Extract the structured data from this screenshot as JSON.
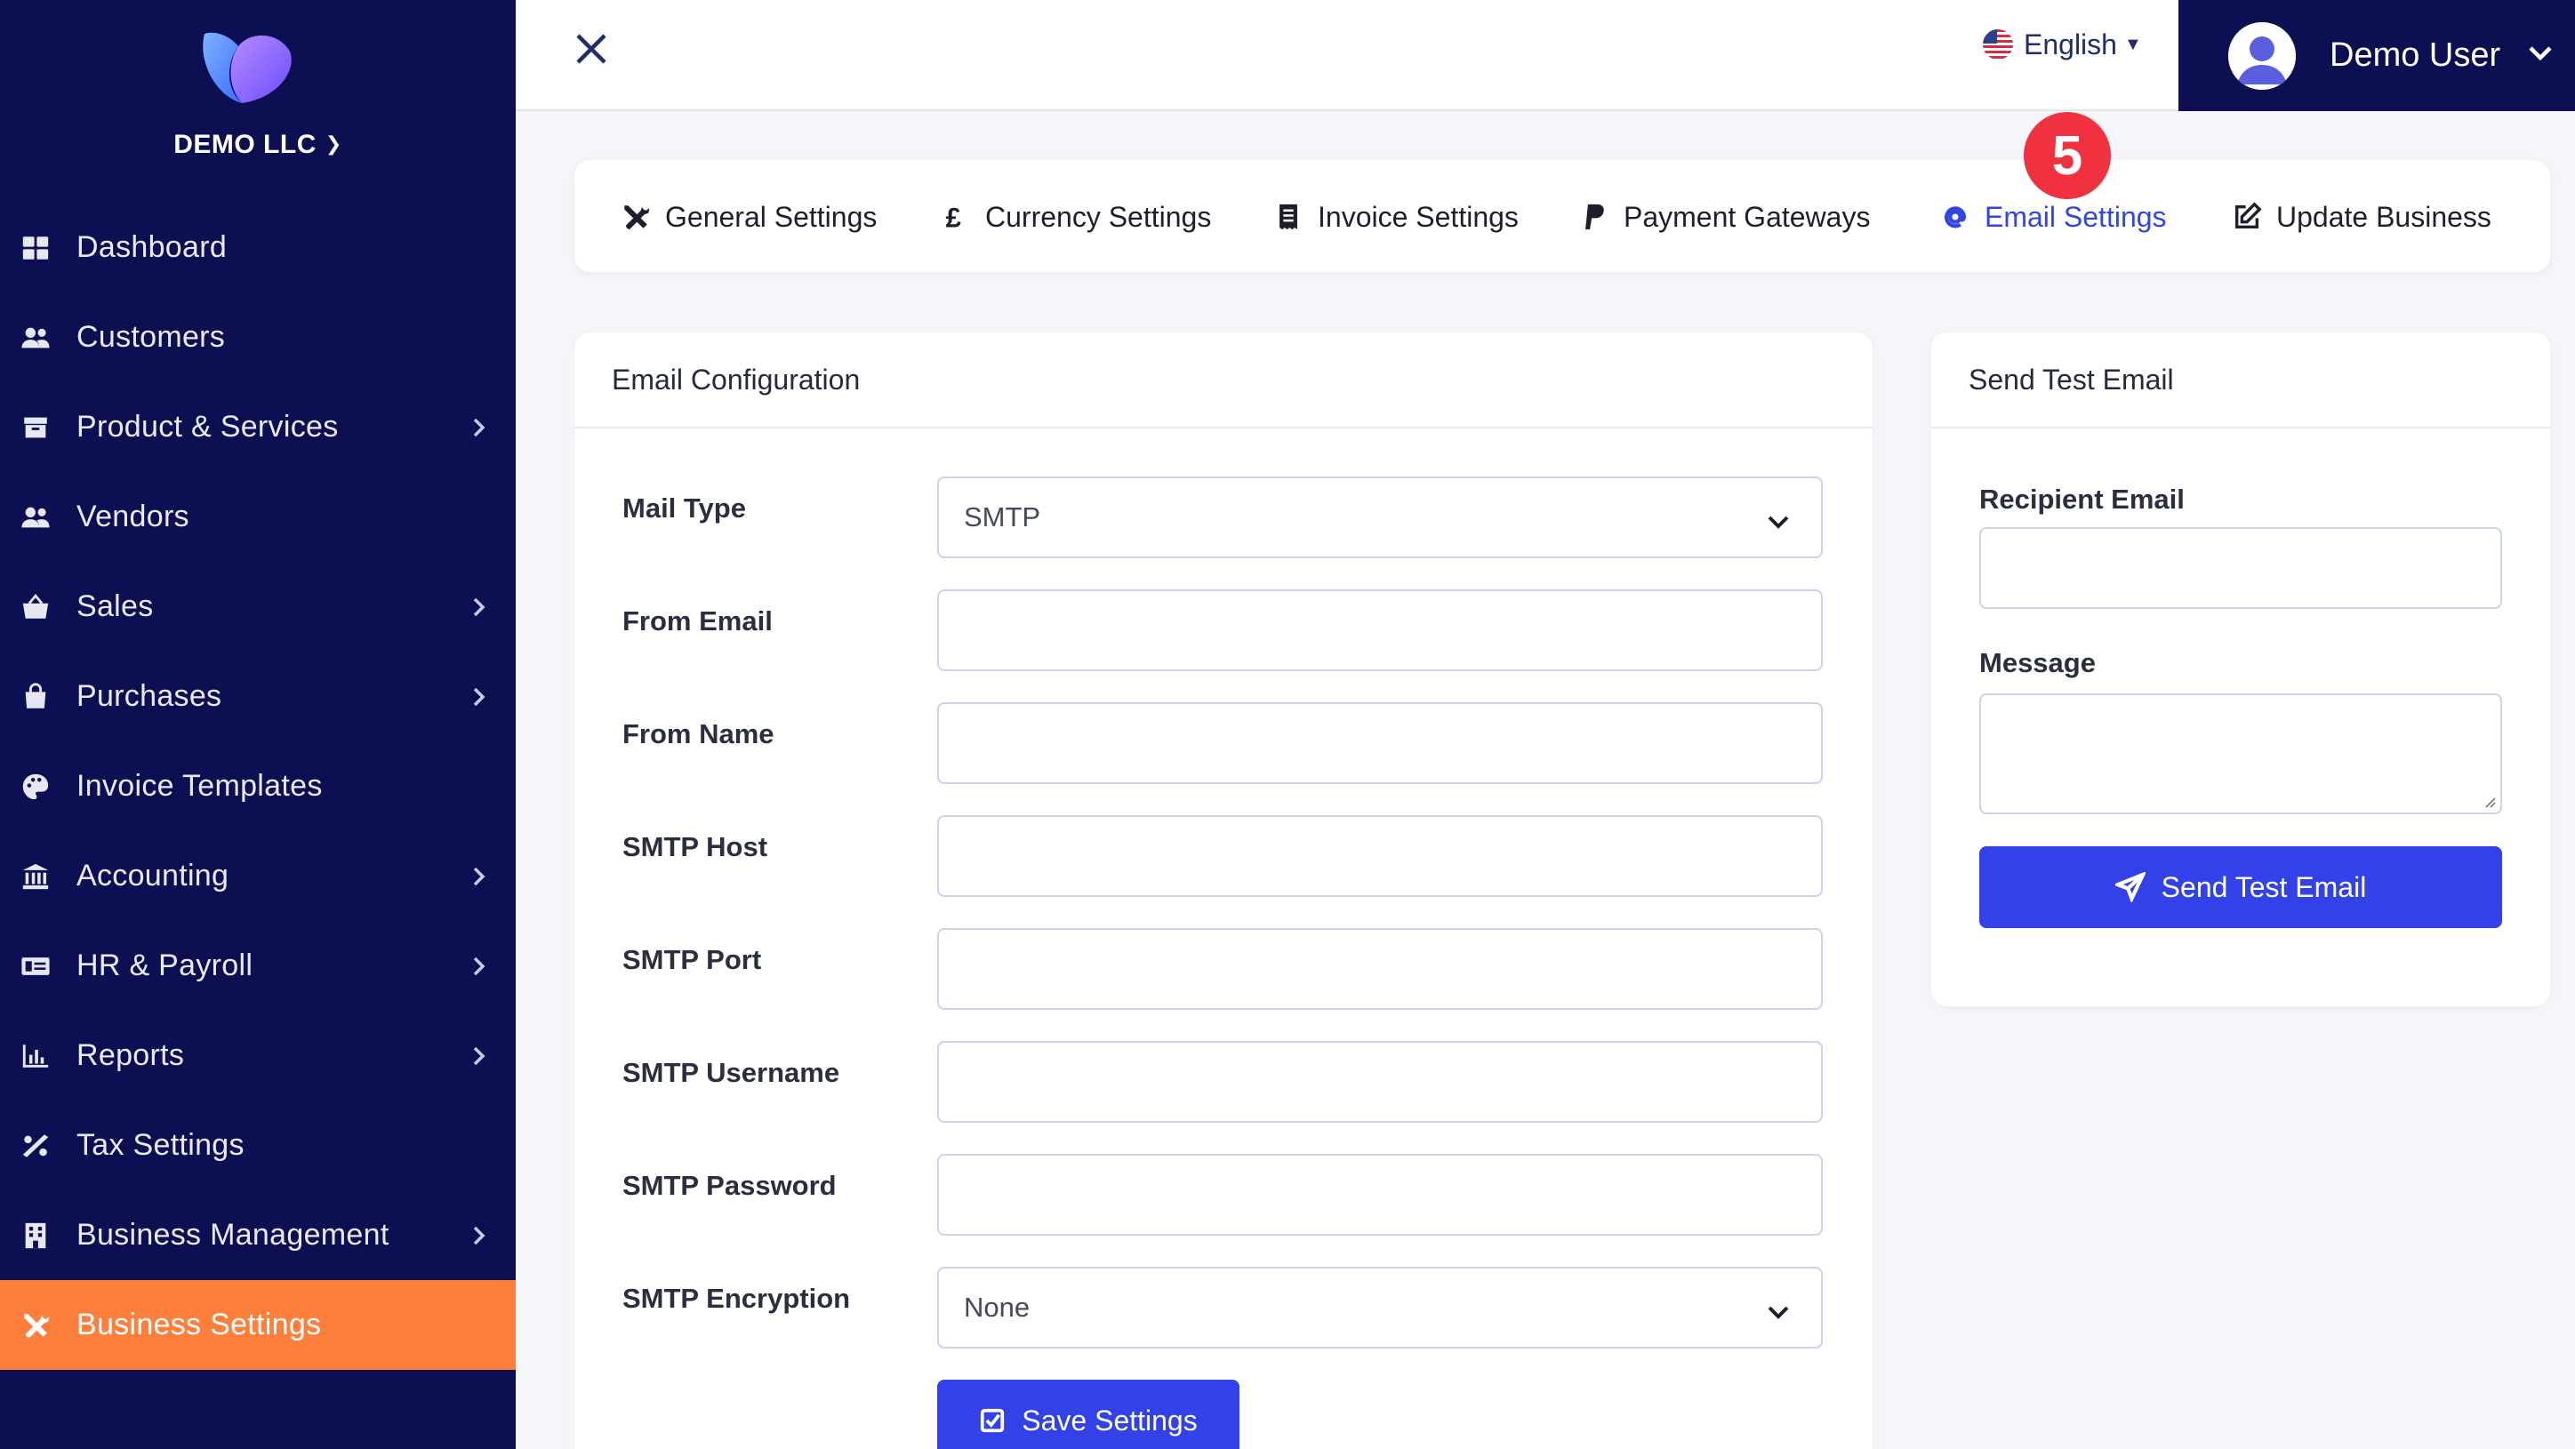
{
  "sidebar": {
    "company": "DEMO LLC",
    "items": [
      {
        "label": "Dashboard",
        "icon": "grid-icon",
        "has_submenu": false
      },
      {
        "label": "Customers",
        "icon": "users-icon",
        "has_submenu": false
      },
      {
        "label": "Product & Services",
        "icon": "box-icon",
        "has_submenu": true
      },
      {
        "label": "Vendors",
        "icon": "users-icon",
        "has_submenu": false
      },
      {
        "label": "Sales",
        "icon": "basket-icon",
        "has_submenu": true
      },
      {
        "label": "Purchases",
        "icon": "bag-icon",
        "has_submenu": true
      },
      {
        "label": "Invoice Templates",
        "icon": "palette-icon",
        "has_submenu": false
      },
      {
        "label": "Accounting",
        "icon": "bank-icon",
        "has_submenu": true
      },
      {
        "label": "HR & Payroll",
        "icon": "money-card-icon",
        "has_submenu": true
      },
      {
        "label": "Reports",
        "icon": "bar-chart-icon",
        "has_submenu": true
      },
      {
        "label": "Tax Settings",
        "icon": "percent-icon",
        "has_submenu": false
      },
      {
        "label": "Business Management",
        "icon": "building-icon",
        "has_submenu": true
      },
      {
        "label": "Business Settings",
        "icon": "tools-icon",
        "has_submenu": false,
        "active": true
      }
    ]
  },
  "topbar": {
    "language": "English",
    "user_name": "Demo User"
  },
  "tabs": [
    {
      "label": "General Settings",
      "icon": "tools-icon"
    },
    {
      "label": "Currency Settings",
      "icon": "pound-icon"
    },
    {
      "label": "Invoice Settings",
      "icon": "receipt-icon"
    },
    {
      "label": "Payment Gateways",
      "icon": "paypal-icon"
    },
    {
      "label": "Email Settings",
      "icon": "at-icon",
      "active": true
    },
    {
      "label": "Update Business",
      "icon": "edit-icon"
    }
  ],
  "step_badge": "5",
  "email_config": {
    "title": "Email Configuration",
    "fields": {
      "mail_type": {
        "label": "Mail Type",
        "value": "SMTP"
      },
      "from_email": {
        "label": "From Email",
        "value": ""
      },
      "from_name": {
        "label": "From Name",
        "value": ""
      },
      "smtp_host": {
        "label": "SMTP Host",
        "value": ""
      },
      "smtp_port": {
        "label": "SMTP Port",
        "value": ""
      },
      "smtp_username": {
        "label": "SMTP Username",
        "value": ""
      },
      "smtp_password": {
        "label": "SMTP Password",
        "value": ""
      },
      "smtp_encryption": {
        "label": "SMTP Encryption",
        "value": "None"
      }
    },
    "save_label": "Save Settings"
  },
  "test_email": {
    "title": "Send Test Email",
    "recipient_label": "Recipient Email",
    "message_label": "Message",
    "send_label": "Send Test Email"
  },
  "colors": {
    "sidebar_bg": "#0c0f52",
    "active_nav": "#fe7f3b",
    "primary": "#3342e8",
    "active_tab": "#3145e6",
    "badge": "#ef3140"
  }
}
